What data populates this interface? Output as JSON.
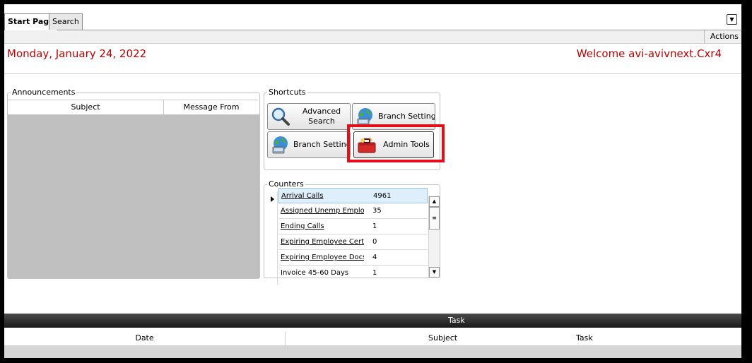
{
  "tabs": [
    {
      "label": "Start Page",
      "active": true
    },
    {
      "label": "Search",
      "active": false
    }
  ],
  "toolbar": {
    "actions_label": "Actions"
  },
  "header": {
    "date": "Monday, January 24, 2022",
    "welcome": "Welcome avi-avivnext.Cxr4",
    "accent_color": "#c00000"
  },
  "announcements": {
    "title": "Announcements",
    "columns": [
      "Subject",
      "Message From"
    ]
  },
  "shortcuts": {
    "title": "Shortcuts",
    "buttons": [
      {
        "label": "Advanced Search",
        "icon": "magnifier-icon"
      },
      {
        "label": "Branch Settings",
        "icon": "globe-computer-icon"
      },
      {
        "label": "Branch Settings",
        "icon": "globe-computer-icon"
      },
      {
        "label": "Admin Tools",
        "icon": "toolbox-icon",
        "highlighted": true
      }
    ]
  },
  "counters": {
    "title": "Counters",
    "rows": [
      {
        "name": "Arrival Calls",
        "value": "4961",
        "selected": true
      },
      {
        "name": "Assigned Unemp Emplo",
        "value": "35"
      },
      {
        "name": "Ending Calls",
        "value": "1"
      },
      {
        "name": "Expiring Employee Cert.",
        "value": "0"
      },
      {
        "name": "Expiring Employee Docs",
        "value": "4"
      },
      {
        "name": "Invoice 45-60 Days",
        "value": "1"
      }
    ]
  },
  "task": {
    "title": "Task",
    "columns": [
      "Date",
      "Subject",
      "Task"
    ]
  },
  "highlight_color": "#e3101a"
}
